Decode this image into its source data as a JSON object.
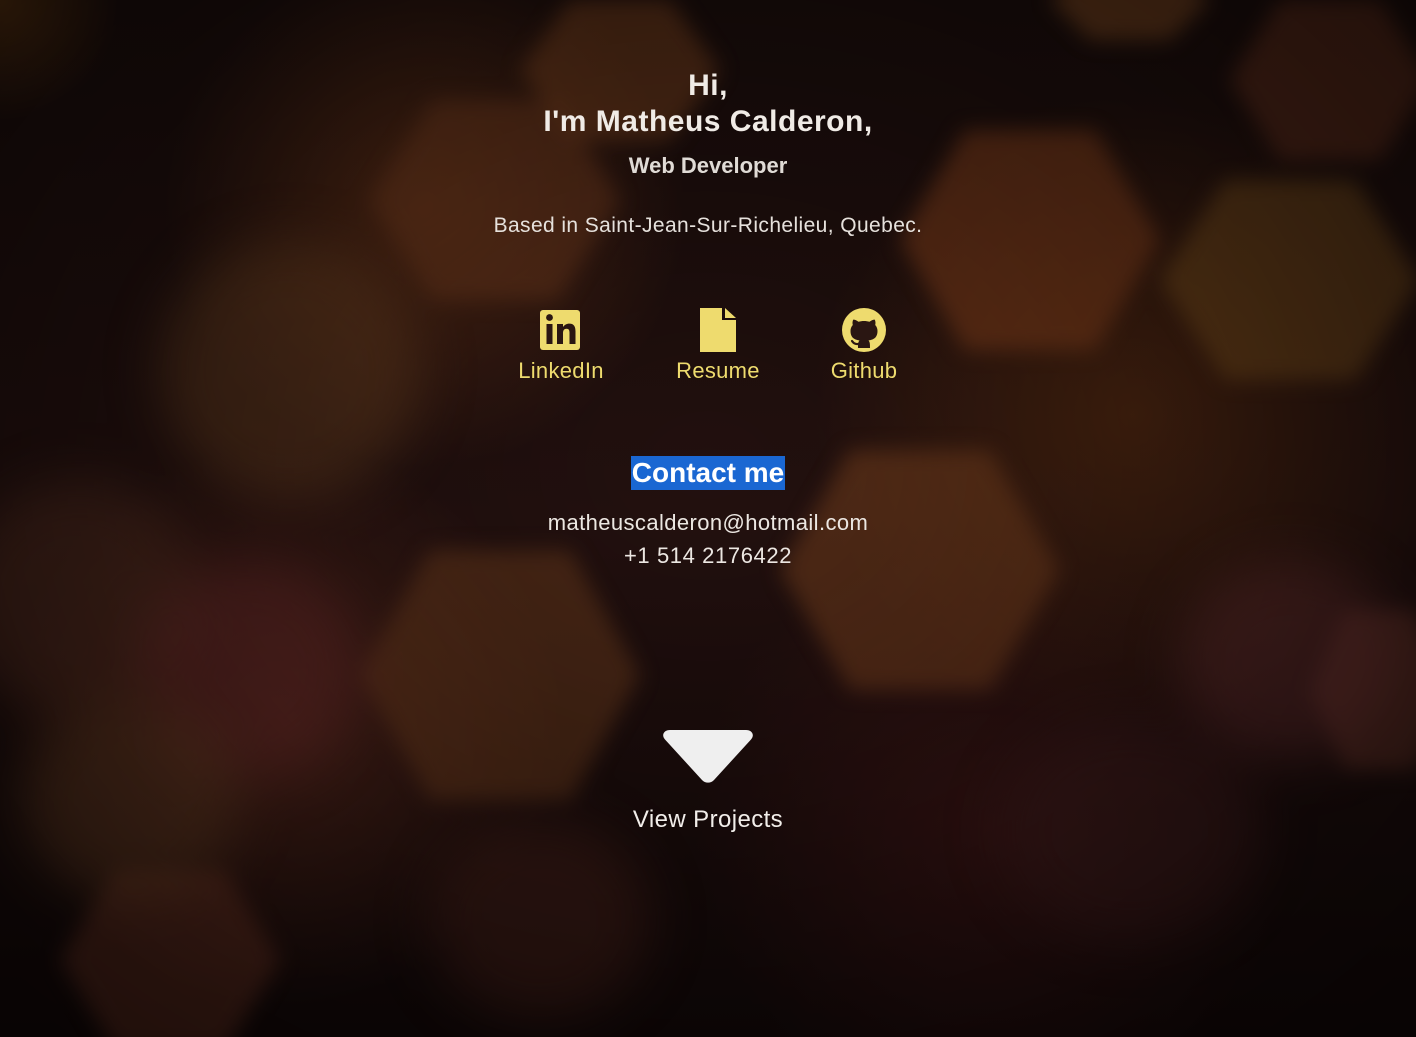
{
  "hero": {
    "greeting_line1": "Hi,",
    "greeting_line2": "I'm Matheus Calderon,",
    "role": "Web Developer",
    "location": "Based in Saint-Jean-Sur-Richelieu, Quebec."
  },
  "socials": [
    {
      "label": "LinkedIn",
      "icon": "linkedin-icon"
    },
    {
      "label": "Resume",
      "icon": "document-icon"
    },
    {
      "label": "Github",
      "icon": "github-icon"
    }
  ],
  "contact": {
    "title": "Contact me",
    "email": "matheuscalderon@hotmail.com",
    "phone": "+1 514 2176422"
  },
  "projects": {
    "label": "View Projects",
    "icon": "chevron-down-icon"
  },
  "colors": {
    "accent": "#eedb6e",
    "highlight": "#1a67d2",
    "text": "#f0ebe6"
  }
}
